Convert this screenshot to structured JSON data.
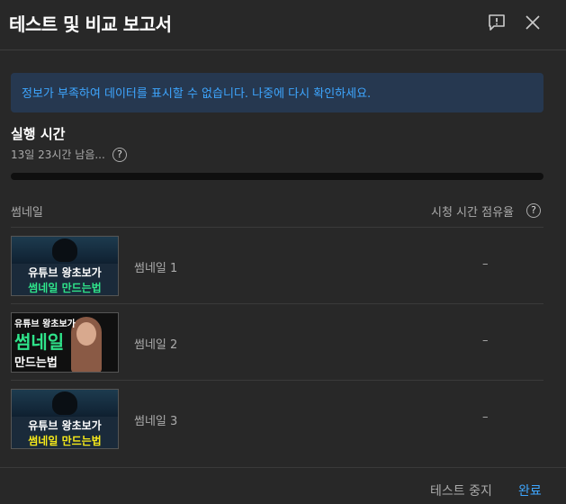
{
  "dialog": {
    "title": "테스트 및 비교 보고서",
    "feedback_icon": "feedback-icon",
    "close_icon": "close-icon"
  },
  "banner": {
    "text": "정보가 부족하여 데이터를 표시할 수 없습니다. 나중에 다시 확인하세요."
  },
  "runtime": {
    "title": "실행 시간",
    "remaining": "13일 23시간 남음...",
    "help": "?",
    "progress_fraction": 0.0
  },
  "table": {
    "col_thumbnail": "썸네일",
    "col_watch_share": "시청 시간 점유율",
    "help": "?",
    "rows": [
      {
        "label": "썸네일 1",
        "value": "–",
        "thumb_line1": "유튜브 왕초보가",
        "thumb_line2": "썸네일 만드는법"
      },
      {
        "label": "썸네일 2",
        "value": "–",
        "thumb_line1": "유튜브 왕초보가",
        "thumb_line2": "썸네일",
        "thumb_line3": "만드는법"
      },
      {
        "label": "썸네일 3",
        "value": "–",
        "thumb_line1": "유튜브 왕초보가",
        "thumb_line2": "썸네일 만드는법"
      }
    ]
  },
  "footer": {
    "stop_label": "테스트 중지",
    "done_label": "완료"
  },
  "colors": {
    "background": "#282828",
    "accent": "#3ea6ff",
    "banner_bg": "#263850",
    "thumb_green": "#2fe38a",
    "thumb_yellow": "#f6e91a"
  }
}
